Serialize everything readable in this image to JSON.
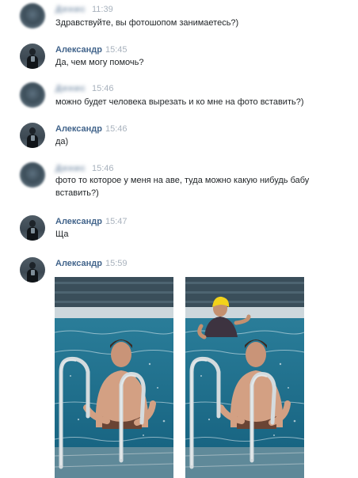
{
  "messages": [
    {
      "name": "Денис",
      "time": "11:39",
      "text": "Здравствуйте, вы фотошопом занимаетесь?)"
    },
    {
      "name": "Александр",
      "time": "15:45",
      "text": "Да, чем могу помочь?"
    },
    {
      "name": "Денис",
      "time": "15:46",
      "text": "можно будет человека вырезать и ко мне на фото вставить?)"
    },
    {
      "name": "Александр",
      "time": "15:46",
      "text": "да)"
    },
    {
      "name": "Денис",
      "time": "15:46",
      "text": "фото то которое у меня на аве, туда можно какую нибудь бабу вставить?)"
    },
    {
      "name": "Александр",
      "time": "15:47",
      "text": "Ща"
    },
    {
      "name": "Александр",
      "time": "15:59",
      "text": ""
    }
  ],
  "colors": {
    "author_name": "#42648b",
    "timestamp": "#a8b2bd",
    "message_text": "#1f2326",
    "pool_water": "#1b6f8e"
  },
  "attachments": [
    {
      "icon": "photo-original"
    },
    {
      "icon": "photo-edited"
    }
  ]
}
